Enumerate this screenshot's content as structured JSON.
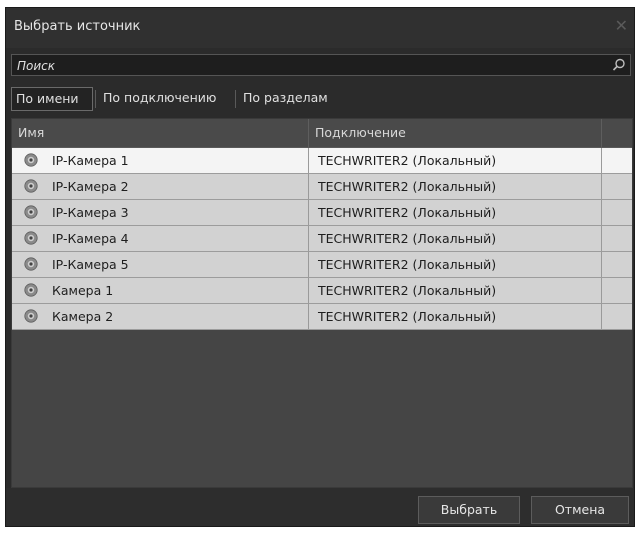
{
  "dialog": {
    "title": "Выбрать источник",
    "close_glyph": "✕"
  },
  "search": {
    "placeholder": "Поиск",
    "icon": "search-icon"
  },
  "tabs": [
    {
      "label": "По имени",
      "active": true
    },
    {
      "label": "По подключению",
      "active": false
    },
    {
      "label": "По разделам",
      "active": false
    }
  ],
  "table": {
    "columns": [
      "Имя",
      "Подключение"
    ],
    "rows": [
      {
        "name": "IP-Камера 1",
        "connection": "TECHWRITER2 (Локальный)",
        "selected": true
      },
      {
        "name": "IP-Камера 2",
        "connection": "TECHWRITER2 (Локальный)",
        "selected": false
      },
      {
        "name": "IP-Камера 3",
        "connection": "TECHWRITER2 (Локальный)",
        "selected": false
      },
      {
        "name": "IP-Камера 4",
        "connection": "TECHWRITER2 (Локальный)",
        "selected": false
      },
      {
        "name": "IP-Камера 5",
        "connection": "TECHWRITER2 (Локальный)",
        "selected": false
      },
      {
        "name": "Камера 1",
        "connection": "TECHWRITER2 (Локальный)",
        "selected": false
      },
      {
        "name": "Камера 2",
        "connection": "TECHWRITER2 (Локальный)",
        "selected": false
      }
    ],
    "row_icon": "camera-icon"
  },
  "footer": {
    "select_label": "Выбрать",
    "cancel_label": "Отмена"
  }
}
